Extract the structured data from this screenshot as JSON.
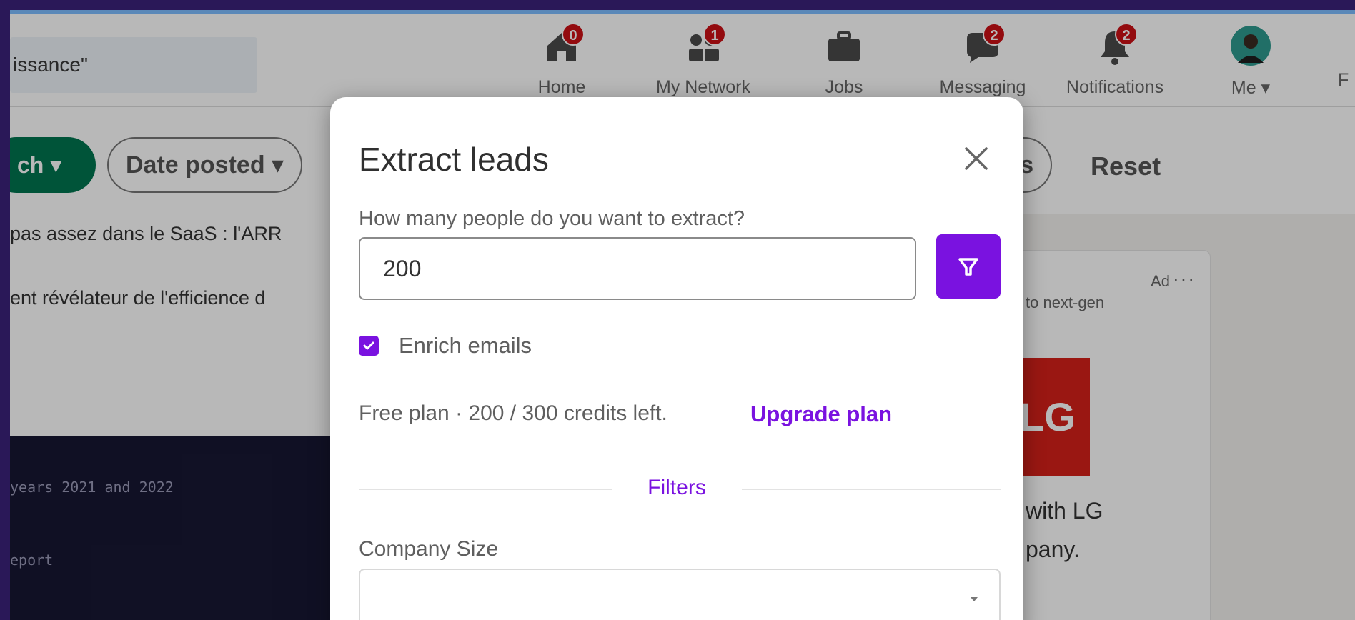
{
  "search": {
    "value": "issance\""
  },
  "nav": {
    "items": [
      {
        "label": "Home",
        "icon": "home-icon",
        "badge": "0"
      },
      {
        "label": "My Network",
        "icon": "network-icon",
        "badge": "1"
      },
      {
        "label": "Jobs",
        "icon": "briefcase-icon",
        "badge": ""
      },
      {
        "label": "Messaging",
        "icon": "message-icon",
        "badge": "2"
      },
      {
        "label": "Notifications",
        "icon": "bell-icon",
        "badge": "2"
      },
      {
        "label": "Me ▾",
        "icon": "avatar",
        "badge": ""
      }
    ],
    "cutoff": "F"
  },
  "filters": {
    "active_pill": "ch ▾",
    "date_posted": "Date posted ▾",
    "partial_pill": "rs",
    "reset": "Reset"
  },
  "feed": {
    "line1": "pas assez dans le SaaS : l'ARR",
    "line2": "ent révélateur de l'efficience d",
    "mono1": "years 2021 and 2022",
    "mono2": "eport",
    "mono3": "eport"
  },
  "ad": {
    "label": "Ad",
    "more": "···",
    "subtitle": "to next-gen",
    "logo": "LG",
    "line1": "with LG",
    "line2": "pany."
  },
  "modal": {
    "title": "Extract leads",
    "quantity_label": "How many people do you want to extract?",
    "quantity_value": "200",
    "enrich_label": "Enrich emails",
    "enrich_checked": true,
    "plan_text": "Free plan · 200 / 300 credits left.",
    "upgrade_link": "Upgrade plan",
    "filters_heading": "Filters",
    "company_size_label": "Company Size",
    "company_size_value": ""
  },
  "colors": {
    "accent": "#7a12e0",
    "search_pill": "#01754f",
    "badge": "#cc1016",
    "outer_frame": "#2a1858"
  }
}
